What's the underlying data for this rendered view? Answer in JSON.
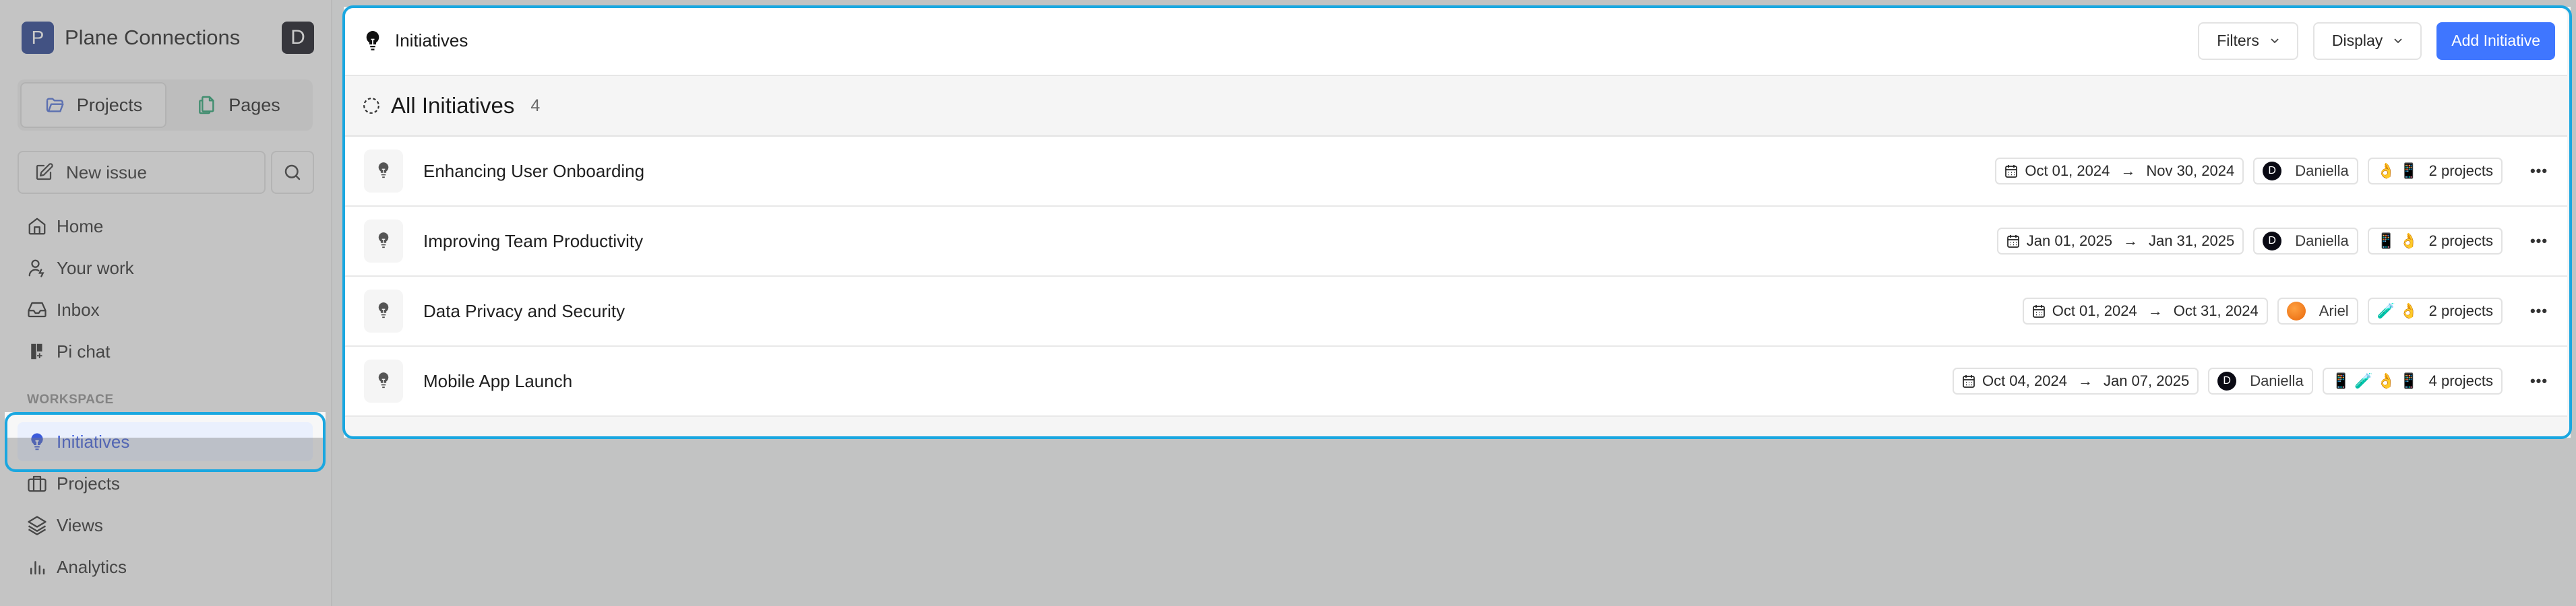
{
  "sidebar": {
    "workspace": {
      "initial": "P",
      "name": "Plane Connections"
    },
    "user_initial": "D",
    "segment": [
      {
        "label": "Projects",
        "icon": "folder-icon",
        "active": true
      },
      {
        "label": "Pages",
        "icon": "pages-icon",
        "active": false
      }
    ],
    "new_issue_label": "New issue",
    "nav": [
      {
        "label": "Home",
        "icon": "home-icon"
      },
      {
        "label": "Your work",
        "icon": "user-activity-icon"
      },
      {
        "label": "Inbox",
        "icon": "inbox-icon"
      },
      {
        "label": "Pi chat",
        "icon": "pi-chat-icon"
      }
    ],
    "workspace_label": "WORKSPACE",
    "workspace_nav": [
      {
        "label": "Initiatives",
        "icon": "lightbulb-icon",
        "active": true
      },
      {
        "label": "Projects",
        "icon": "briefcase-icon"
      },
      {
        "label": "Views",
        "icon": "layers-icon"
      },
      {
        "label": "Analytics",
        "icon": "bar-chart-icon"
      }
    ]
  },
  "header": {
    "title": "Initiatives",
    "filters_label": "Filters",
    "display_label": "Display",
    "add_label": "Add Initiative"
  },
  "group": {
    "title": "All Initiatives",
    "count": "4"
  },
  "initiatives": [
    {
      "title": "Enhancing User Onboarding",
      "start": "Oct 01, 2024",
      "end": "Nov 30, 2024",
      "lead": "Daniella",
      "lead_initial": "D",
      "lead_avatar": "dark",
      "project_emojis": "👌 📱",
      "projects": "2 projects"
    },
    {
      "title": "Improving Team Productivity",
      "start": "Jan 01, 2025",
      "end": "Jan 31, 2025",
      "lead": "Daniella",
      "lead_initial": "D",
      "lead_avatar": "dark",
      "project_emojis": "📱 👌",
      "projects": "2 projects"
    },
    {
      "title": "Data Privacy and Security",
      "start": "Oct 01, 2024",
      "end": "Oct 31, 2024",
      "lead": "Ariel",
      "lead_initial": "",
      "lead_avatar": "orange",
      "project_emojis": "🧪 👌",
      "projects": "2 projects"
    },
    {
      "title": "Mobile App Launch",
      "start": "Oct 04, 2024",
      "end": "Jan 07, 2025",
      "lead": "Daniella",
      "lead_initial": "D",
      "lead_avatar": "dark",
      "project_emojis": "📱 🧪 👌 📱",
      "projects": "4 projects"
    }
  ],
  "arrow_glyph": "→",
  "more_glyph": "•••",
  "colors": {
    "accent": "#3f76ff",
    "highlight_outline": "#1aa7e0",
    "workspace_logo": "#1e3a8a",
    "active_nav_text": "#3b5bdb"
  }
}
